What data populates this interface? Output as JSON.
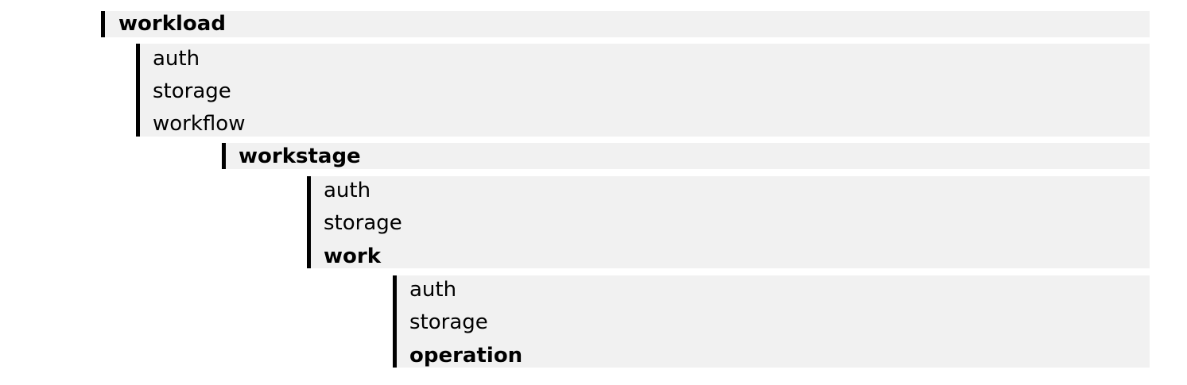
{
  "tree": {
    "root": {
      "label": "workload",
      "children": [
        "auth",
        "storage",
        "workflow"
      ]
    },
    "level2": {
      "label": "workstage",
      "children": [
        "auth",
        "storage",
        "work"
      ]
    },
    "level3": {
      "children": [
        "auth",
        "storage",
        "operation"
      ]
    }
  },
  "colors": {
    "block_background": "#f1f1f1",
    "bar": "#000000",
    "text": "#000000"
  }
}
